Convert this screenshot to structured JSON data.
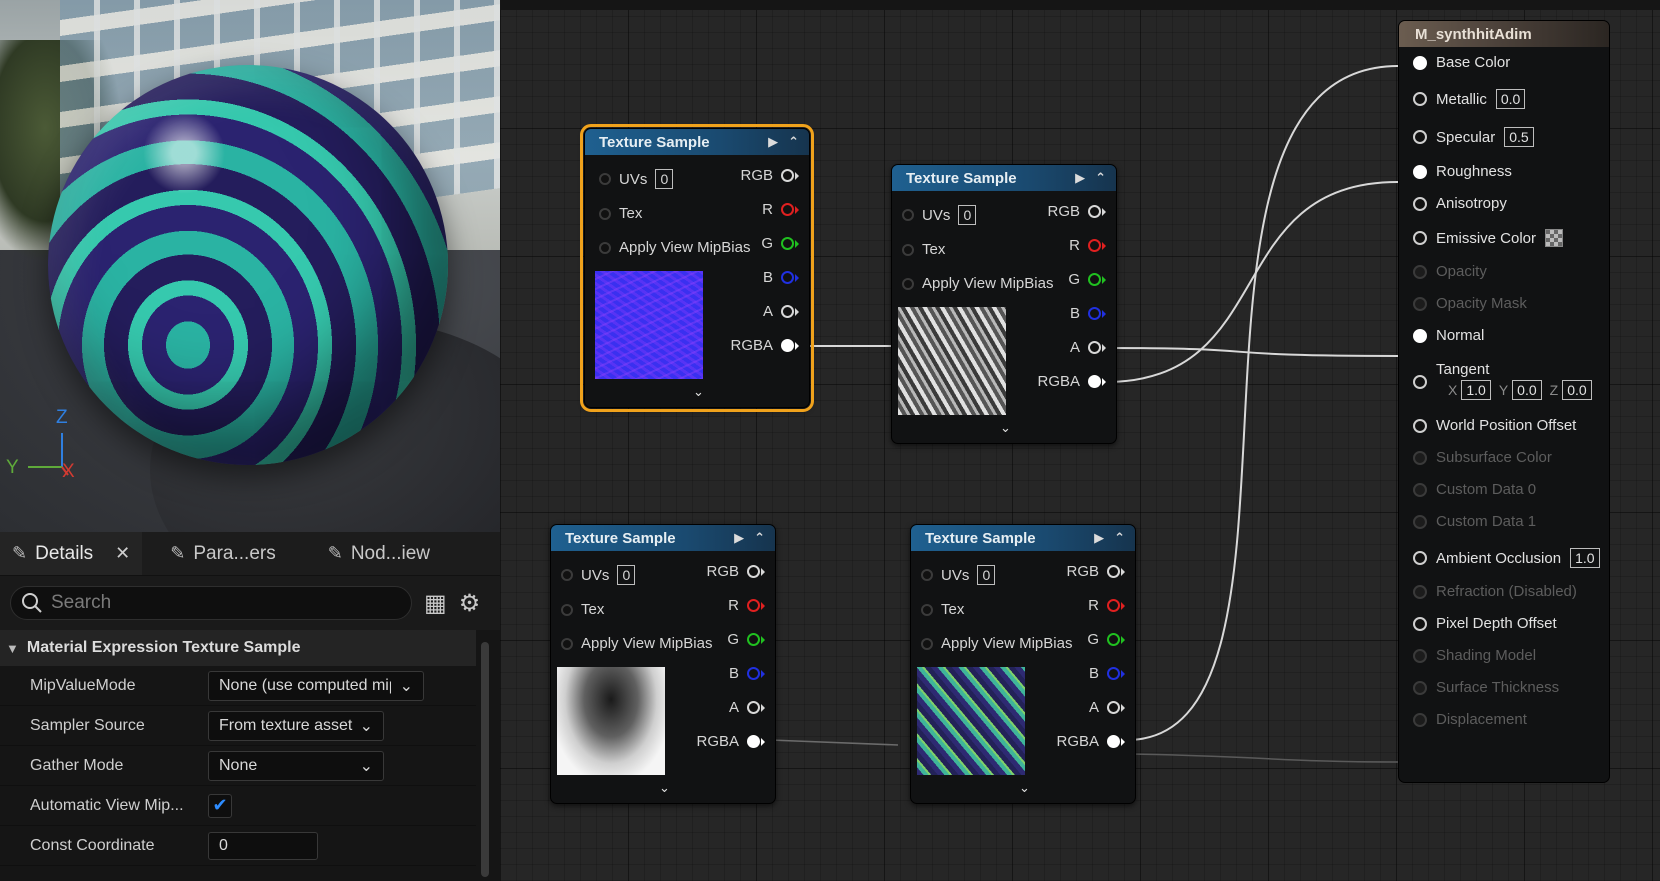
{
  "viewport": {
    "axis": {
      "z": "Z",
      "y": "Y",
      "x": "X"
    },
    "colors": {
      "z": "#2f7fe0",
      "y": "#5faa3a",
      "x": "#d23b32"
    }
  },
  "details": {
    "tabs": [
      {
        "label": "Details",
        "icon": "pencil-icon",
        "active": true
      },
      {
        "label": "Para...ers",
        "icon": "pencil-icon",
        "active": false
      },
      {
        "label": "Nod...iew",
        "icon": "pencil-icon",
        "active": false
      }
    ],
    "search": {
      "placeholder": "Search"
    },
    "category": "Material Expression Texture Sample",
    "properties": {
      "mip_value_mode": {
        "label": "MipValueMode",
        "value": "None (use computed mip"
      },
      "sampler_source": {
        "label": "Sampler Source",
        "value": "From texture asset"
      },
      "gather_mode": {
        "label": "Gather Mode",
        "value": "None"
      },
      "auto_view_mip": {
        "label": "Automatic View Mip...",
        "checked": true
      },
      "const_coordinate": {
        "label": "Const Coordinate",
        "value": "0"
      }
    }
  },
  "graph": {
    "texture_node": {
      "title": "Texture Sample",
      "inputs": {
        "uvs": "UVs",
        "uvs_value": "0",
        "tex": "Tex",
        "mip": "Apply View MipBias"
      },
      "outputs": {
        "rgb": "RGB",
        "r": "R",
        "g": "G",
        "b": "B",
        "a": "A",
        "rgba": "RGBA"
      },
      "colors": {
        "r": "#e02020",
        "g": "#20c020",
        "b": "#2030e0"
      }
    },
    "material_node": {
      "title": "M_synthhitAdim",
      "pins": {
        "base_color": "Base Color",
        "metallic": "Metallic",
        "metallic_value": "0.0",
        "specular": "Specular",
        "specular_value": "0.5",
        "roughness": "Roughness",
        "anisotropy": "Anisotropy",
        "emissive": "Emissive Color",
        "opacity": "Opacity",
        "opacity_mask": "Opacity Mask",
        "normal": "Normal",
        "tangent": "Tangent",
        "tangent_x_label": "X",
        "tangent_x": "1.0",
        "tangent_y_label": "Y",
        "tangent_y": "0.0",
        "tangent_z_label": "Z",
        "tangent_z": "0.0",
        "wpo": "World Position Offset",
        "subsurface": "Subsurface Color",
        "custom0": "Custom Data 0",
        "custom1": "Custom Data 1",
        "ao": "Ambient Occlusion",
        "ao_value": "1.0",
        "refraction": "Refraction (Disabled)",
        "pdo": "Pixel Depth Offset",
        "shading_model": "Shading Model",
        "surface_thickness": "Surface Thickness",
        "displacement": "Displacement"
      }
    },
    "accent": {
      "selected": "#f0a21c",
      "header": "#1f6090",
      "check": "#2d8cff"
    }
  }
}
